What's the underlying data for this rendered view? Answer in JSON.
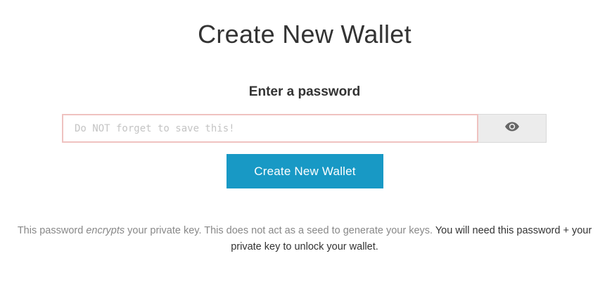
{
  "page": {
    "title": "Create New Wallet",
    "subtitle": "Enter a password"
  },
  "password": {
    "placeholder": "Do NOT forget to save this!",
    "value": "",
    "toggle_icon": "eye-icon"
  },
  "actions": {
    "create_label": "Create New Wallet",
    "create_color": "#1899c5"
  },
  "note": {
    "part1": "This password ",
    "emphasis": "encrypts",
    "part2": " your private key. This does not act as a seed to generate your keys. ",
    "strong": "You will need this password + your private key to unlock your wallet."
  }
}
